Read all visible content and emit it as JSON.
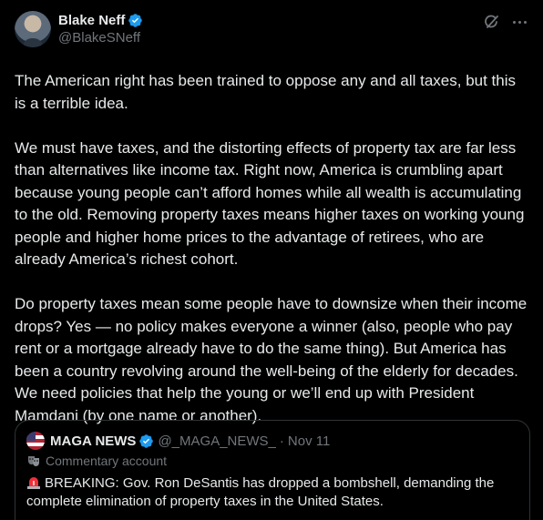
{
  "author": {
    "display_name": "Blake Neff",
    "handle": "@BlakeSNeff"
  },
  "post": {
    "paragraphs": [
      "The American right has been trained to oppose any and all taxes, but this is a terrible idea.",
      "We must have taxes, and the distorting effects of property tax are far less than alternatives like income tax. Right now, America is crumbling apart because young people can’t afford homes while all wealth is accumulating to the old. Removing property taxes means higher taxes on working young people and higher home prices to the advantage of retirees, who are already America’s richest cohort.",
      "Do property taxes mean some people have to downsize when their income drops? Yes — no policy makes everyone a winner (also, people who pay rent or a mortgage already have to do the same thing). But America has been a country revolving around the well-being of the elderly for decades. We need policies that help the young or we’ll end up with President Mamdani (by one name or another)."
    ]
  },
  "quote": {
    "display_name": "MAGA NEWS",
    "handle": "@_MAGA_NEWS_",
    "separator": "·",
    "date": "Nov 11",
    "account_label": "Commentary account",
    "text": "BREAKING: Gov. Ron DeSantis has dropped a bombshell, demanding the complete elimination of property taxes in the United States."
  },
  "icons": {
    "verified": "verified-badge-icon",
    "grok": "grok-icon",
    "more": "more-icon",
    "label": "theater-mask-icon",
    "siren": "siren-icon"
  },
  "colors": {
    "background": "#000000",
    "text": "#e7e9ea",
    "secondary": "#71767b",
    "verified": "#1d9bf0",
    "border": "#2f3336"
  }
}
